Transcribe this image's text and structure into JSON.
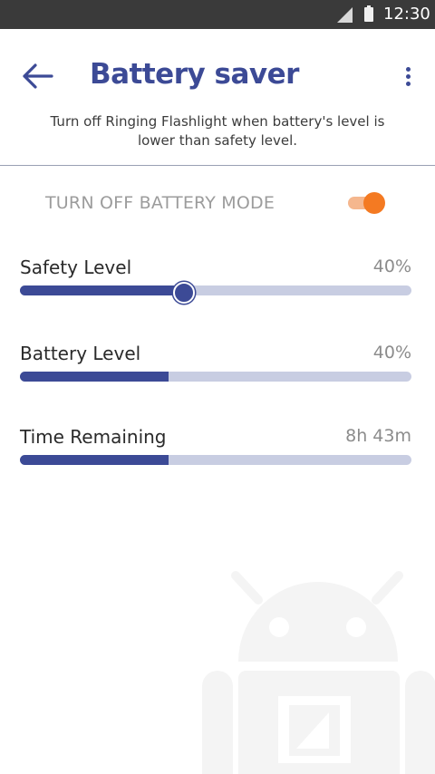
{
  "status_bar": {
    "time": "12:30",
    "icons": [
      "signal-icon",
      "battery-icon"
    ]
  },
  "header": {
    "title": "Battery saver",
    "description": "Turn off Ringing Flashlight when battery's level is lower than safety level.",
    "icons": [
      "back-arrow-icon",
      "more-vert-icon"
    ]
  },
  "toggle": {
    "label": "TURN OFF BATTERY MODE",
    "on": true
  },
  "settings": [
    {
      "label": "Safety Level",
      "value": "40%",
      "fraction": 0.42,
      "type": "slider"
    },
    {
      "label": "Battery Level",
      "value": "40%",
      "fraction": 0.38,
      "type": "progress"
    },
    {
      "label": "Time Remaining",
      "value": "8h 43m",
      "fraction": 0.38,
      "type": "progress"
    }
  ],
  "colors": {
    "accent": "#3c4a96",
    "toggle_on": "#f47a22",
    "track": "#c8cde2",
    "status_bar": "#3a3a3a"
  }
}
